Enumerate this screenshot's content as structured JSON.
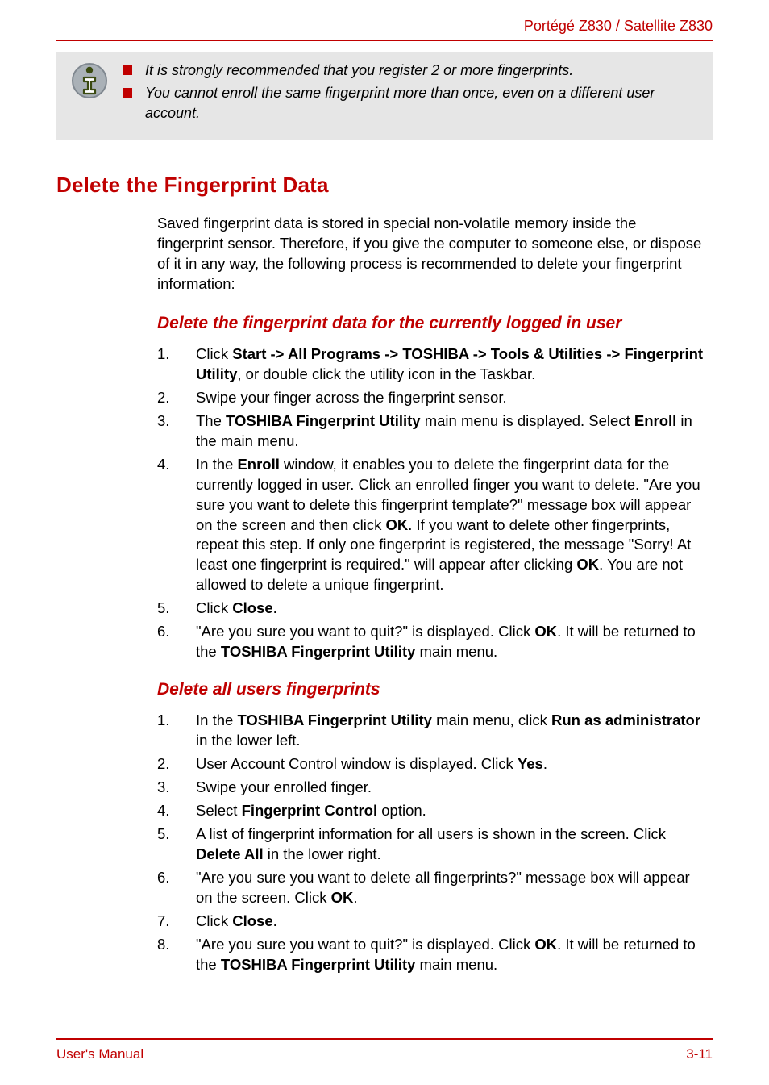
{
  "header": {
    "product": "Portégé Z830 / Satellite Z830"
  },
  "note": {
    "items": [
      "It is strongly recommended that you register 2 or more fingerprints.",
      "You cannot enroll the same fingerprint more than once, even on a different user account."
    ]
  },
  "section": {
    "title": "Delete the Fingerprint Data",
    "intro": "Saved fingerprint data is stored in special non-volatile memory inside the fingerprint sensor. Therefore, if you give the computer to someone else, or dispose of it in any way, the following process is recommended to delete your fingerprint information:"
  },
  "sub1": {
    "title": "Delete the fingerprint data for the currently logged in user",
    "steps": {
      "s1a": "Click ",
      "s1b": "Start -> All Programs -> TOSHIBA -> Tools & Utilities -> Fingerprint Utility",
      "s1c": ", or double click the utility icon in the Taskbar.",
      "s2": "Swipe your finger across the fingerprint sensor.",
      "s3a": "The ",
      "s3b": "TOSHIBA Fingerprint Utility",
      "s3c": " main menu is displayed. Select ",
      "s3d": "Enroll",
      "s3e": " in the main menu.",
      "s4a": "In the ",
      "s4b": "Enroll",
      "s4c": " window, it enables you to delete the fingerprint data for the currently logged in user. Click an enrolled finger you want to delete. \"Are you sure you want to delete this fingerprint template?\" message box will appear on the screen and then click ",
      "s4d": "OK",
      "s4e": ". If you want to delete other fingerprints, repeat this step. If only one fingerprint is registered, the message \"Sorry! At least one fingerprint is required.\" will appear after clicking ",
      "s4f": "OK",
      "s4g": ". You are not allowed to delete a unique fingerprint.",
      "s5a": "Click ",
      "s5b": "Close",
      "s5c": ".",
      "s6a": "\"Are you sure you want to quit?\" is displayed. Click ",
      "s6b": "OK",
      "s6c": ". It will be returned to the ",
      "s6d": "TOSHIBA Fingerprint Utility",
      "s6e": " main menu."
    }
  },
  "sub2": {
    "title": "Delete all users fingerprints",
    "steps": {
      "s1a": "In the ",
      "s1b": "TOSHIBA Fingerprint Utility",
      "s1c": " main menu, click ",
      "s1d": "Run as administrator",
      "s1e": " in the lower left.",
      "s2a": "User Account Control window is displayed. Click ",
      "s2b": "Yes",
      "s2c": ".",
      "s3": "Swipe your enrolled finger.",
      "s4a": "Select ",
      "s4b": "Fingerprint Control",
      "s4c": " option.",
      "s5a": "A list of fingerprint information for all users is shown in the screen. Click ",
      "s5b": "Delete All",
      "s5c": " in the lower right.",
      "s6a": "\"Are you sure you want to delete all fingerprints?\" message box will appear on the screen. Click ",
      "s6b": "OK",
      "s6c": ".",
      "s7a": "Click ",
      "s7b": "Close",
      "s7c": ".",
      "s8a": "\"Are you sure you want to quit?\" is displayed. Click ",
      "s8b": "OK",
      "s8c": ". It will be returned to the ",
      "s8d": "TOSHIBA Fingerprint Utility",
      "s8e": " main menu."
    }
  },
  "footer": {
    "left": "User's Manual",
    "right": "3-11"
  }
}
